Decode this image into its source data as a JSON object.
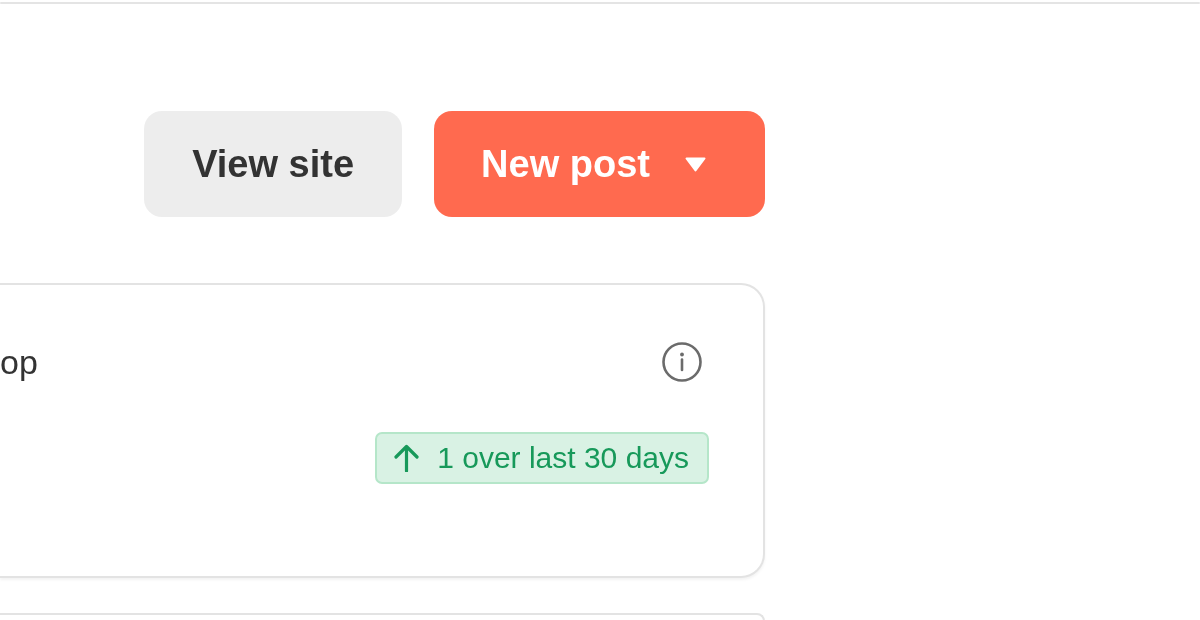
{
  "header": {
    "buttons": [
      {
        "label": "View site",
        "kind": "secondary",
        "has_menu": false
      },
      {
        "label": "New post",
        "kind": "primary",
        "has_menu": true
      }
    ]
  },
  "card": {
    "title": "op",
    "trend": {
      "rising": true,
      "text": "1 over last 30 days"
    }
  }
}
